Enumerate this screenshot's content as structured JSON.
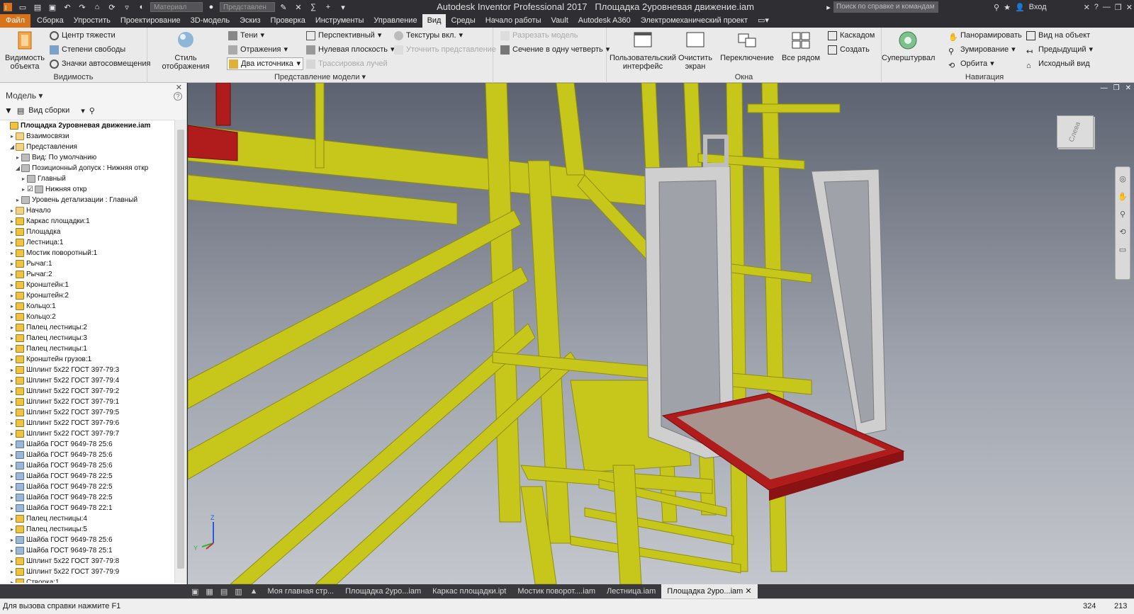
{
  "titlebar": {
    "app_title": "Autodesk Inventor Professional 2017",
    "doc_title": "Площадка 2уровневая движение.iam",
    "material_placeholder": "Материал",
    "appearance_placeholder": "Представлен",
    "search_placeholder": "Поиск по справке и командам",
    "signin": "Вход"
  },
  "tabs": [
    "Файл",
    "Сборка",
    "Упростить",
    "Проектирование",
    "3D-модель",
    "Эскиз",
    "Проверка",
    "Инструменты",
    "Управление",
    "Вид",
    "Среды",
    "Начало работы",
    "Vault",
    "Autodesk A360",
    "Электромеханический проект"
  ],
  "active_tab": "Вид",
  "ribbon": {
    "visibility": {
      "big": "Видимость объекта",
      "items": [
        "Центр тяжести",
        "Степени свободы",
        "Значки автосовмещения"
      ],
      "label": "Видимость"
    },
    "model_view": {
      "style": "Стиль отображения",
      "col1": [
        "Тени",
        "Отражения",
        "Два источника"
      ],
      "col2": [
        "Перспективный",
        "Нулевая плоскость",
        "Трассировка лучей"
      ],
      "col3": [
        "Текстуры вкл.",
        "Уточнить представление"
      ],
      "col4": [
        "Разрезать модель",
        "Сечение в одну четверть"
      ],
      "label": "Представление модели"
    },
    "windows": {
      "ui": "Пользовательский интерфейс",
      "clear": "Очистить экран",
      "switch": "Переключение",
      "tile": "Все рядом",
      "items": [
        "Каскадом",
        "Создать"
      ],
      "label": "Окна"
    },
    "navigation": {
      "wheel": "Суперштурвал",
      "col1": [
        "Панорамировать",
        "Зумирование",
        "Орбита"
      ],
      "col2": [
        "Вид на объект",
        "Предыдущий",
        "Исходный вид"
      ],
      "label": "Навигация"
    }
  },
  "browser": {
    "header": "Модель",
    "view_mode": "Вид сборки",
    "tree": [
      {
        "label": "Площадка 2уровневая движение.iam",
        "indent": 0,
        "icon": "asm",
        "bold": true
      },
      {
        "label": "Взаимосвязи",
        "indent": 1,
        "icon": "folder"
      },
      {
        "label": "Представления",
        "indent": 1,
        "icon": "folder",
        "open": true
      },
      {
        "label": "Вид: По умолчанию",
        "indent": 2,
        "icon": "view"
      },
      {
        "label": "Позиционный допуск : Нижняя откр",
        "indent": 2,
        "icon": "view",
        "open": true
      },
      {
        "label": "Главный",
        "indent": 3,
        "icon": "view"
      },
      {
        "label": "Нижняя откр",
        "indent": 3,
        "icon": "view",
        "checked": true
      },
      {
        "label": "Уровень детализации : Главный",
        "indent": 2,
        "icon": "view"
      },
      {
        "label": "Начало",
        "indent": 1,
        "icon": "folder"
      },
      {
        "label": "Каркас площадки:1",
        "indent": 1,
        "icon": "asm"
      },
      {
        "label": "Площадка",
        "indent": 1,
        "icon": "asm"
      },
      {
        "label": "Лестница:1",
        "indent": 1,
        "icon": "asm"
      },
      {
        "label": "Мостик поворотный:1",
        "indent": 1,
        "icon": "asm"
      },
      {
        "label": "Рычаг:1",
        "indent": 1,
        "icon": "asm"
      },
      {
        "label": "Рычаг:2",
        "indent": 1,
        "icon": "asm"
      },
      {
        "label": "Кронштейн:1",
        "indent": 1,
        "icon": "asm"
      },
      {
        "label": "Кронштейн:2",
        "indent": 1,
        "icon": "asm"
      },
      {
        "label": "Кольцо:1",
        "indent": 1,
        "icon": "asm"
      },
      {
        "label": "Кольцо:2",
        "indent": 1,
        "icon": "asm"
      },
      {
        "label": "Палец лестницы:2",
        "indent": 1,
        "icon": "asm"
      },
      {
        "label": "Палец лестницы:3",
        "indent": 1,
        "icon": "asm"
      },
      {
        "label": "Палец лестницы:1",
        "indent": 1,
        "icon": "asm"
      },
      {
        "label": "Кронштейн грузов:1",
        "indent": 1,
        "icon": "asm"
      },
      {
        "label": "Шплинт 5х22 ГОСТ 397-79:3",
        "indent": 1,
        "icon": "asm"
      },
      {
        "label": "Шплинт 5х22 ГОСТ 397-79:4",
        "indent": 1,
        "icon": "asm"
      },
      {
        "label": "Шплинт 5х22 ГОСТ 397-79:2",
        "indent": 1,
        "icon": "asm"
      },
      {
        "label": "Шплинт 5х22 ГОСТ 397-79:1",
        "indent": 1,
        "icon": "asm"
      },
      {
        "label": "Шплинт 5х22 ГОСТ 397-79:5",
        "indent": 1,
        "icon": "asm"
      },
      {
        "label": "Шплинт 5х22 ГОСТ 397-79:6",
        "indent": 1,
        "icon": "asm"
      },
      {
        "label": "Шплинт 5х22 ГОСТ 397-79:7",
        "indent": 1,
        "icon": "asm"
      },
      {
        "label": "Шайба ГОСТ 9649-78 25:6",
        "indent": 1,
        "icon": "part"
      },
      {
        "label": "Шайба ГОСТ 9649-78 25:6",
        "indent": 1,
        "icon": "part"
      },
      {
        "label": "Шайба ГОСТ 9649-78 25:6",
        "indent": 1,
        "icon": "part"
      },
      {
        "label": "Шайба ГОСТ 9649-78 22:5",
        "indent": 1,
        "icon": "part"
      },
      {
        "label": "Шайба ГОСТ 9649-78 22:5",
        "indent": 1,
        "icon": "part"
      },
      {
        "label": "Шайба ГОСТ 9649-78 22:5",
        "indent": 1,
        "icon": "part"
      },
      {
        "label": "Шайба ГОСТ 9649-78 22:1",
        "indent": 1,
        "icon": "part"
      },
      {
        "label": "Палец лестницы:4",
        "indent": 1,
        "icon": "asm"
      },
      {
        "label": "Палец лестницы:5",
        "indent": 1,
        "icon": "asm"
      },
      {
        "label": "Шайба ГОСТ 9649-78 25:6",
        "indent": 1,
        "icon": "part"
      },
      {
        "label": "Шайба ГОСТ 9649-78 25:1",
        "indent": 1,
        "icon": "part"
      },
      {
        "label": "Шплинт 5х22 ГОСТ 397-79:8",
        "indent": 1,
        "icon": "asm"
      },
      {
        "label": "Шплинт 5х22 ГОСТ 397-79:9",
        "indent": 1,
        "icon": "asm"
      },
      {
        "label": "Створка:1",
        "indent": 1,
        "icon": "asm"
      }
    ]
  },
  "viewcube_label": "Слева",
  "doc_tabs": [
    "Моя главная стр...",
    "Площадка 2уро...iam",
    "Каркас площадки.ipt",
    "Мостик поворот....iam",
    "Лестница.iam",
    "Площадка 2уро...iam"
  ],
  "active_doc_tab": 5,
  "status": {
    "message": "Для вызова справки нажмите F1",
    "count1": "324",
    "count2": "213"
  },
  "colors": {
    "accent": "#d9731a",
    "frame_yellow": "#c8c81a",
    "gate_gray": "#c9c9c9",
    "platform_red": "#b01c1c"
  }
}
